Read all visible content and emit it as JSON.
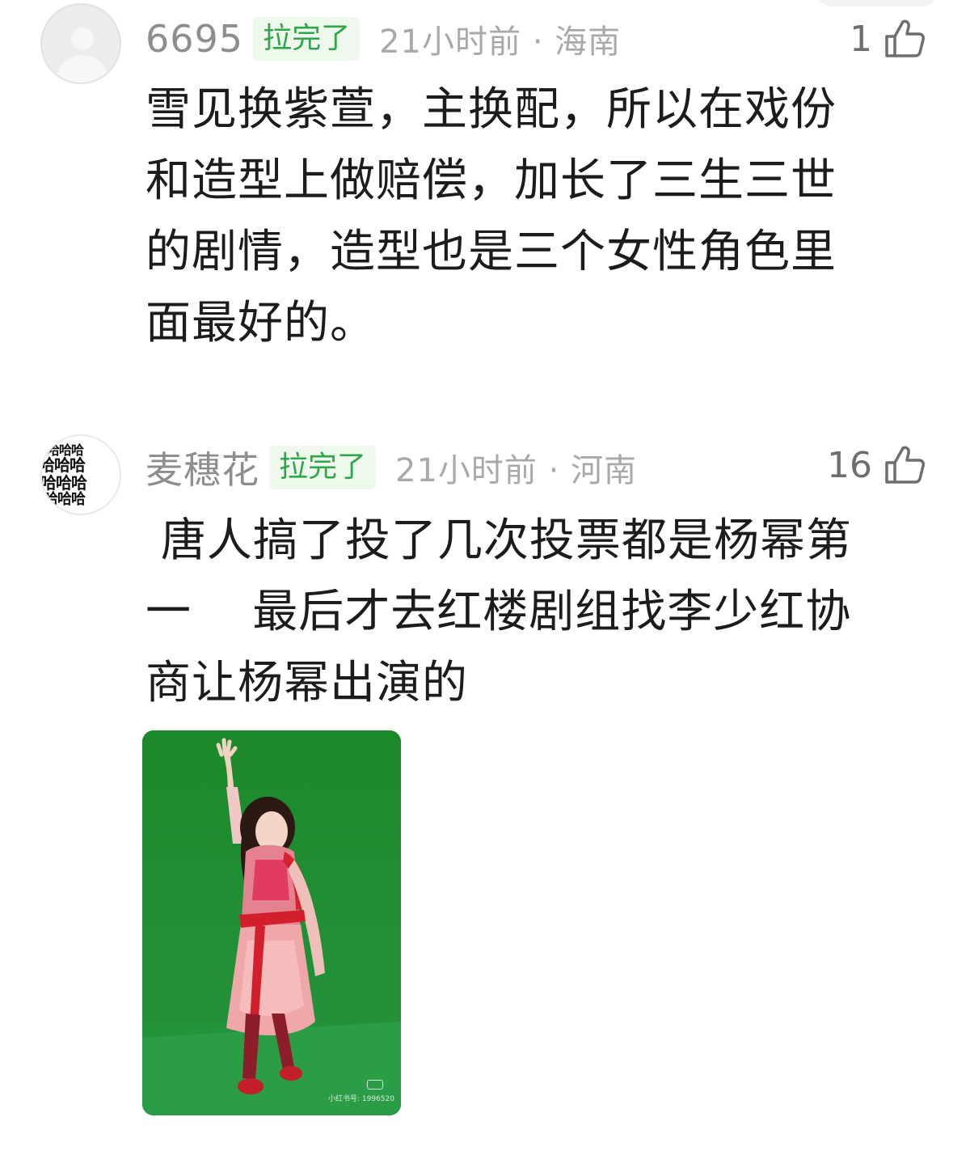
{
  "comments": [
    {
      "username": "6695",
      "badge": "拉完了",
      "meta": "21小时前 · 海南",
      "likes": "1",
      "text": "雪见换紫萱，主换配，所以在戏份\n和造型上做赔偿，加长了三生三世\n的剧情，造型也是三个女性角色里\n面最好的。"
    },
    {
      "username": "麦穗花",
      "badge": "拉完了",
      "meta": "21小时前 · 河南",
      "likes": "16",
      "avatar_text": "哈哈哈",
      "text": " 唐人搞了投了几次投票都是杨幂第\n一    最后才去红楼剧组找李少红协\n商让杨幂出演的",
      "image": {
        "watermark": "小红书号: 1996520"
      }
    }
  ],
  "colors": {
    "badge_text": "#2fa64a",
    "badge_bg": "#eef8ec",
    "username": "#8d8d8d",
    "meta": "#a9a9a9",
    "photo_bg": "#1f8a2c"
  },
  "icons": [
    "thumbs-up-icon",
    "avatar-placeholder-icon"
  ]
}
